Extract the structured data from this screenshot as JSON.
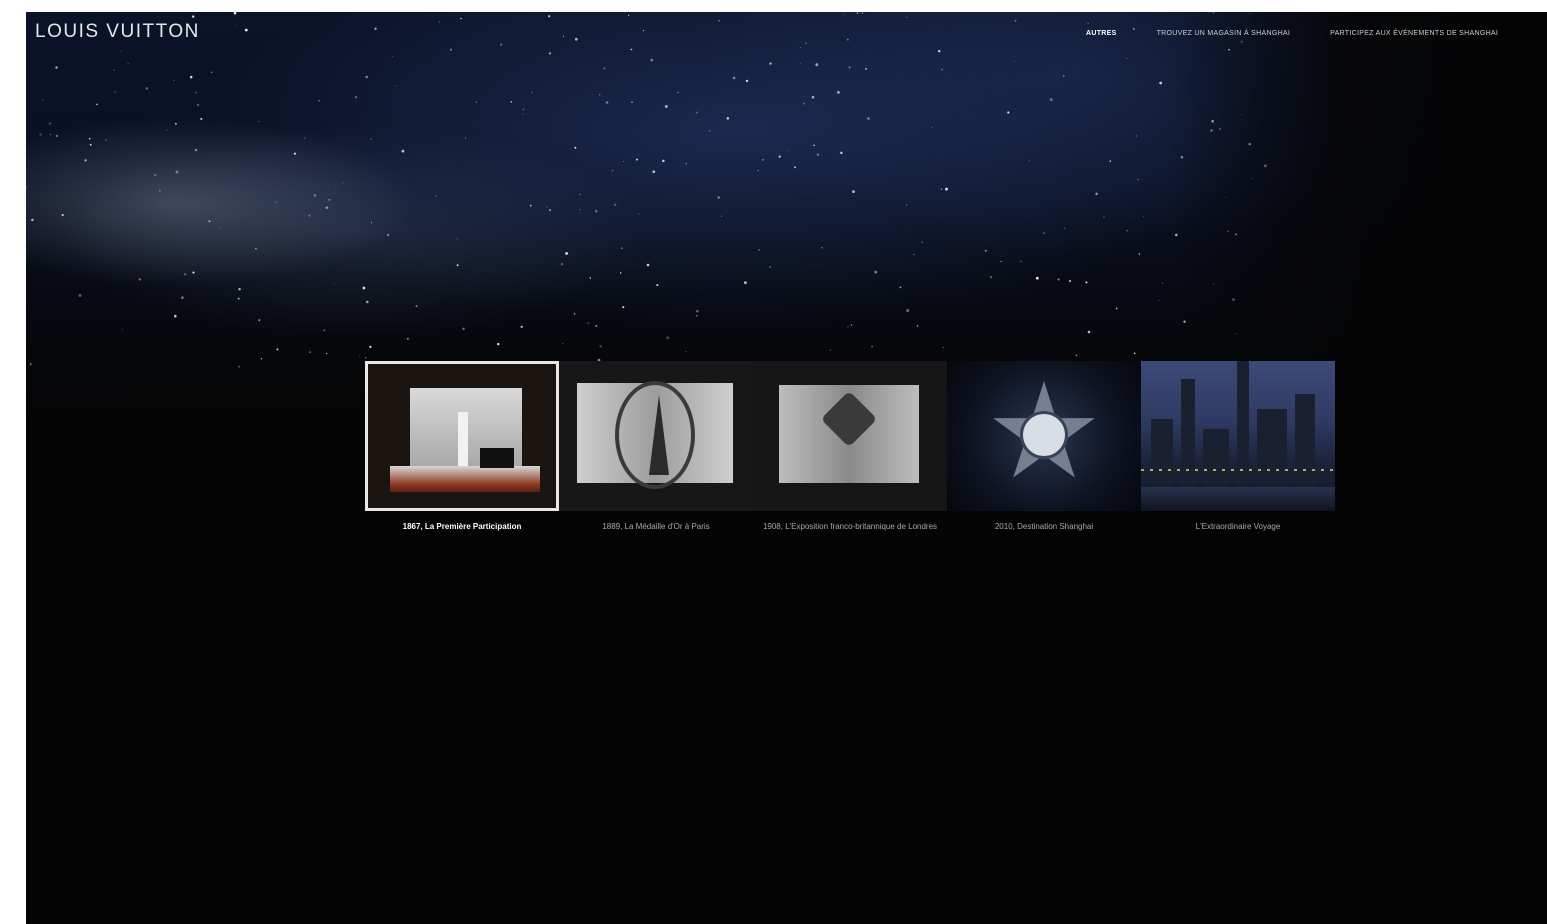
{
  "header": {
    "logo_text": "LOUIS VUITTON",
    "nav": [
      {
        "label": "AUTRES",
        "active": true
      },
      {
        "label": "TROUVEZ UN MAGASIN À SHANGHAI",
        "active": false
      },
      {
        "label": "PARTICIPEZ AUX ÉVÉNEMENTS DE SHANGHAI",
        "active": false
      }
    ]
  },
  "gallery": {
    "items": [
      {
        "caption": "1867, La Première Participation",
        "selected": true,
        "thumb_icon": "exhibition-box-image"
      },
      {
        "caption": "1889, La Médaille d'Or à Paris",
        "selected": false,
        "thumb_icon": "popup-book-eiffel-image"
      },
      {
        "caption": "1908, L'Exposition franco-britannique de Londres",
        "selected": false,
        "thumb_icon": "popup-book-heart-image"
      },
      {
        "caption": "2010, Destination Shanghai",
        "selected": false,
        "thumb_icon": "star-medallion-image"
      },
      {
        "caption": "L'Extraordinaire Voyage",
        "selected": false,
        "thumb_icon": "city-night-image"
      }
    ]
  },
  "colors": {
    "background": "#040404",
    "sky": "#0b1328",
    "text_active": "#ffffff",
    "text_muted": "#a8a8a8"
  }
}
